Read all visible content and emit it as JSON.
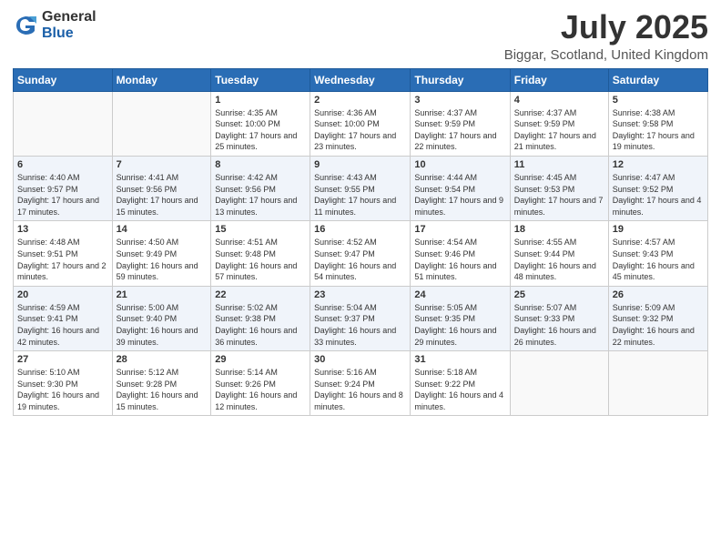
{
  "logo": {
    "general": "General",
    "blue": "Blue"
  },
  "title": "July 2025",
  "subtitle": "Biggar, Scotland, United Kingdom",
  "days_of_week": [
    "Sunday",
    "Monday",
    "Tuesday",
    "Wednesday",
    "Thursday",
    "Friday",
    "Saturday"
  ],
  "weeks": [
    [
      {
        "day": "",
        "info": ""
      },
      {
        "day": "",
        "info": ""
      },
      {
        "day": "1",
        "info": "Sunrise: 4:35 AM\nSunset: 10:00 PM\nDaylight: 17 hours and 25 minutes."
      },
      {
        "day": "2",
        "info": "Sunrise: 4:36 AM\nSunset: 10:00 PM\nDaylight: 17 hours and 23 minutes."
      },
      {
        "day": "3",
        "info": "Sunrise: 4:37 AM\nSunset: 9:59 PM\nDaylight: 17 hours and 22 minutes."
      },
      {
        "day": "4",
        "info": "Sunrise: 4:37 AM\nSunset: 9:59 PM\nDaylight: 17 hours and 21 minutes."
      },
      {
        "day": "5",
        "info": "Sunrise: 4:38 AM\nSunset: 9:58 PM\nDaylight: 17 hours and 19 minutes."
      }
    ],
    [
      {
        "day": "6",
        "info": "Sunrise: 4:40 AM\nSunset: 9:57 PM\nDaylight: 17 hours and 17 minutes."
      },
      {
        "day": "7",
        "info": "Sunrise: 4:41 AM\nSunset: 9:56 PM\nDaylight: 17 hours and 15 minutes."
      },
      {
        "day": "8",
        "info": "Sunrise: 4:42 AM\nSunset: 9:56 PM\nDaylight: 17 hours and 13 minutes."
      },
      {
        "day": "9",
        "info": "Sunrise: 4:43 AM\nSunset: 9:55 PM\nDaylight: 17 hours and 11 minutes."
      },
      {
        "day": "10",
        "info": "Sunrise: 4:44 AM\nSunset: 9:54 PM\nDaylight: 17 hours and 9 minutes."
      },
      {
        "day": "11",
        "info": "Sunrise: 4:45 AM\nSunset: 9:53 PM\nDaylight: 17 hours and 7 minutes."
      },
      {
        "day": "12",
        "info": "Sunrise: 4:47 AM\nSunset: 9:52 PM\nDaylight: 17 hours and 4 minutes."
      }
    ],
    [
      {
        "day": "13",
        "info": "Sunrise: 4:48 AM\nSunset: 9:51 PM\nDaylight: 17 hours and 2 minutes."
      },
      {
        "day": "14",
        "info": "Sunrise: 4:50 AM\nSunset: 9:49 PM\nDaylight: 16 hours and 59 minutes."
      },
      {
        "day": "15",
        "info": "Sunrise: 4:51 AM\nSunset: 9:48 PM\nDaylight: 16 hours and 57 minutes."
      },
      {
        "day": "16",
        "info": "Sunrise: 4:52 AM\nSunset: 9:47 PM\nDaylight: 16 hours and 54 minutes."
      },
      {
        "day": "17",
        "info": "Sunrise: 4:54 AM\nSunset: 9:46 PM\nDaylight: 16 hours and 51 minutes."
      },
      {
        "day": "18",
        "info": "Sunrise: 4:55 AM\nSunset: 9:44 PM\nDaylight: 16 hours and 48 minutes."
      },
      {
        "day": "19",
        "info": "Sunrise: 4:57 AM\nSunset: 9:43 PM\nDaylight: 16 hours and 45 minutes."
      }
    ],
    [
      {
        "day": "20",
        "info": "Sunrise: 4:59 AM\nSunset: 9:41 PM\nDaylight: 16 hours and 42 minutes."
      },
      {
        "day": "21",
        "info": "Sunrise: 5:00 AM\nSunset: 9:40 PM\nDaylight: 16 hours and 39 minutes."
      },
      {
        "day": "22",
        "info": "Sunrise: 5:02 AM\nSunset: 9:38 PM\nDaylight: 16 hours and 36 minutes."
      },
      {
        "day": "23",
        "info": "Sunrise: 5:04 AM\nSunset: 9:37 PM\nDaylight: 16 hours and 33 minutes."
      },
      {
        "day": "24",
        "info": "Sunrise: 5:05 AM\nSunset: 9:35 PM\nDaylight: 16 hours and 29 minutes."
      },
      {
        "day": "25",
        "info": "Sunrise: 5:07 AM\nSunset: 9:33 PM\nDaylight: 16 hours and 26 minutes."
      },
      {
        "day": "26",
        "info": "Sunrise: 5:09 AM\nSunset: 9:32 PM\nDaylight: 16 hours and 22 minutes."
      }
    ],
    [
      {
        "day": "27",
        "info": "Sunrise: 5:10 AM\nSunset: 9:30 PM\nDaylight: 16 hours and 19 minutes."
      },
      {
        "day": "28",
        "info": "Sunrise: 5:12 AM\nSunset: 9:28 PM\nDaylight: 16 hours and 15 minutes."
      },
      {
        "day": "29",
        "info": "Sunrise: 5:14 AM\nSunset: 9:26 PM\nDaylight: 16 hours and 12 minutes."
      },
      {
        "day": "30",
        "info": "Sunrise: 5:16 AM\nSunset: 9:24 PM\nDaylight: 16 hours and 8 minutes."
      },
      {
        "day": "31",
        "info": "Sunrise: 5:18 AM\nSunset: 9:22 PM\nDaylight: 16 hours and 4 minutes."
      },
      {
        "day": "",
        "info": ""
      },
      {
        "day": "",
        "info": ""
      }
    ]
  ]
}
